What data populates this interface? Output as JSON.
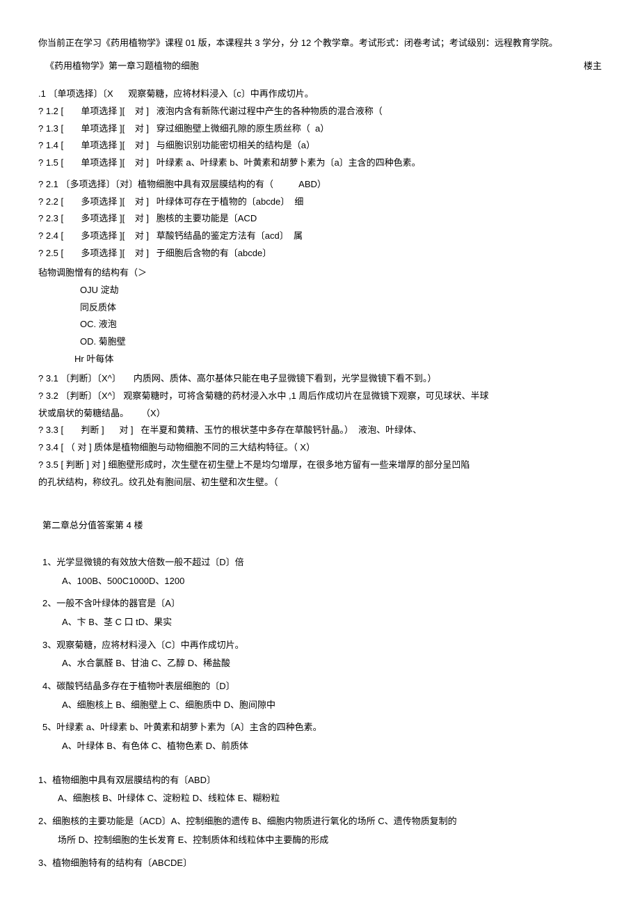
{
  "intro": "你当前正在学习《药用植物学》课程 01 版，本课程共 3 学分，分 12 个教学章。考试形式：闭卷考试；考试级别：远程教育学院。",
  "title": "《药用植物学》第一章习题植物的细胞",
  "louzhu": "楼主",
  "single": {
    "q1": ".1 〔单项选择〕〔X      观察菊糖，应将材料浸入〔c〕中再作成切片。",
    "q2": "? 1.2 [       单项选择 ][    对 ]   液泡内含有新陈代谢过程中产生的各种物质的混合液称（",
    "q3": "? 1.3 [       单项选择 ][    对 ]   穿过细胞壁上微细孔隙的原生质丝称（  a）",
    "q4": "? 1.4 [       单项选择 ][    对 ]   与细胞识别功能密切相关的结构是（a）",
    "q5": "? 1.5 [       单项选择 ][    对 ]   叶绿素 a、叶绿素 b、叶黄素和胡萝卜素为〔a〕主含的四种色素。"
  },
  "multi": {
    "q1": "? 2.1 〔多项选择〕〔对〕植物细胞中具有双层膜结构的有（          ABD）",
    "q2": "? 2.2 [       多项选择 ][    对 ]   叶绿体可存在于植物的〔abcde〕  细",
    "q3": "? 2.3 [       多项选择 ][    对 ]   胞核的主要功能是〔ACD",
    "q4": "? 2.4 [       多项选择 ][    对 ]   草酸钙结晶的鉴定方法有〔acd〕  属",
    "q5": "? 2.5 [       多项选择 ][    对 ]   于细胞后含物的有〔abcde〕"
  },
  "extra": {
    "head": "毡物调胞憎有的结构有（＞",
    "o1": "OJU 淀劫",
    "o2": "同反质体",
    "o3": "OC. 液泡",
    "o4": "OD. 菊胞壁",
    "o5": "Hr 叶每体"
  },
  "judge": {
    "q1": "? 3.1 〔判断〕〔X^〕     内质网、质体、高尔基体只能在电子显微镜下看到，光学显微镜下看不到。）",
    "q2a": "? 3.2 〔判断〕〔X^〕     观察菊糖时，可将含菊糖的药材浸入水中      ,1 周后作成切片在显微镜下观察，可见球状、半球",
    "q2b": "状或扇状的菊糖结晶。     （X）",
    "q3": "? 3.3 [       判断 ]      对 ]   在半夏和黄精、玉竹的根状茎中多存在草酸钙针晶。）  液泡、叶绿体、",
    "q4": "? 3.4 [         （           对 ]   质体是植物细胞与动物细胞不同的三大结构特征。（                                             X）",
    "q5a": "? 3.5 [       判断 ]      对 ]   细胞壁形成时，次生壁在初生壁上不是均匀增厚，在很多地方留有一些来增厚的部分呈凹陷",
    "q5b": "的孔状结构，称纹孔。纹孔处有胞间层、初生壁和次生壁。（"
  },
  "ch2title": "第二章总分值答案第 4 楼",
  "ch2s": {
    "q1": "1、光学显微镜的有效放大倍数一般不超过〔D〕倍",
    "a1": "A、100B、500C1000D、1200",
    "q2": "2、一般不含叶绿体的器官是〔A〕",
    "a2": "A、卞 B、茎 C 口 tD、果实",
    "q3": "3、观察菊糖，应将材料浸入〔C〕中再作成切片。",
    "a3": "A、水合氯醛 B、甘油 C、乙醇 D、稀盐酸",
    "q4": "4、碳酸钙结晶多存在于植物叶表层细胞的〔D〕",
    "a4": "A、细胞核上 B、细胞壁上 C、细胞质中 D、胞间隙中",
    "q5": "5、叶绿素 a、叶绿素 b、叶黄素和胡萝卜素为〔A〕主含的四种色素。",
    "a5": "A、叶绿体 B、有色体 C、植物色素 D、前质体"
  },
  "ch2m": {
    "q1": "1、植物细胞中具有双层膜结构的有〔ABD〕",
    "a1": "A、细胞核 B、叶绿体 C、淀粉粒 D、线粒体 E、糊粉粒",
    "q2": "2、细胞核的主要功能是〔ACD〕A、控制细胞的遗传 B、细胞内物质进行氧化的场所 C、遗传物质复制的",
    "a2": "场所 D、控制细胞的生长发育 E、控制质体和线粒体中主要酶的形成",
    "q3": "3、植物细胞特有的结构有〔ABCDE〕"
  }
}
